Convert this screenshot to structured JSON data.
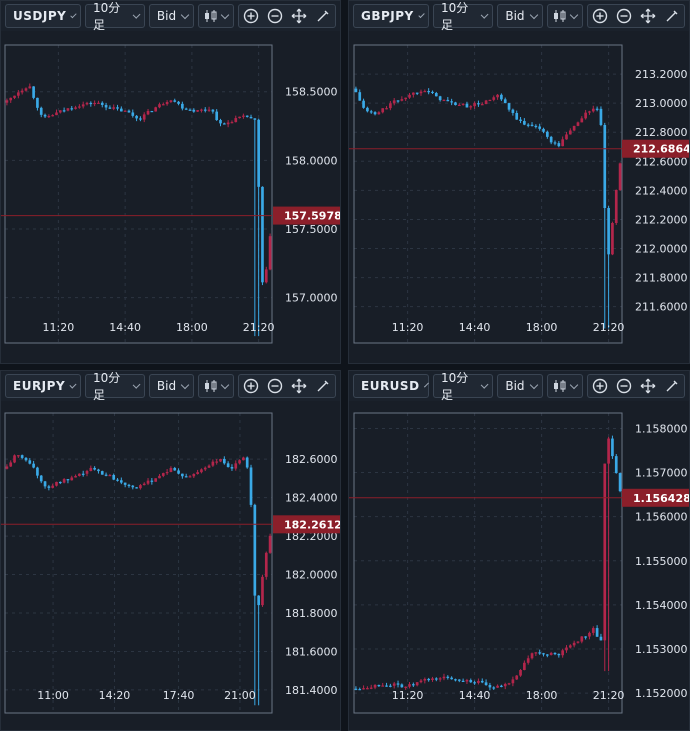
{
  "theme": {
    "up": "#b3264b",
    "down": "#3aa9e6",
    "last": "#8b1f2a",
    "grid": "#2c3542",
    "frame": "#6a7585"
  },
  "panels": [
    {
      "symbol": "USDJPY",
      "interval": "10分足",
      "price_type": "Bid",
      "chart_data": {
        "type": "candlestick",
        "ylim": [
          156.67,
          158.84
        ],
        "yticks": [
          "158.5000",
          "158.0000",
          "157.5000",
          "157.0000"
        ],
        "ytick_values": [
          158.5,
          158.0,
          157.5,
          157.0
        ],
        "xticks": [
          "11:20",
          "14:40",
          "18:00",
          "21:20"
        ],
        "xtick_pos": [
          0.2,
          0.45,
          0.7,
          0.95
        ],
        "last_price": "157.5978",
        "last_value": 157.5978,
        "close_path": [
          [
            0,
            158.42
          ],
          [
            0.05,
            158.5
          ],
          [
            0.09,
            158.55
          ],
          [
            0.14,
            158.3
          ],
          [
            0.2,
            158.35
          ],
          [
            0.27,
            158.4
          ],
          [
            0.34,
            158.42
          ],
          [
            0.4,
            158.38
          ],
          [
            0.46,
            158.35
          ],
          [
            0.5,
            158.3
          ],
          [
            0.56,
            158.38
          ],
          [
            0.62,
            158.45
          ],
          [
            0.67,
            158.38
          ],
          [
            0.72,
            158.36
          ],
          [
            0.77,
            158.38
          ],
          [
            0.81,
            158.25
          ],
          [
            0.86,
            158.3
          ],
          [
            0.91,
            158.32
          ],
          [
            0.94,
            158.28
          ],
          [
            0.95,
            157.8
          ],
          [
            0.96,
            157.15
          ],
          [
            0.97,
            157.05
          ],
          [
            0.985,
            157.3
          ],
          [
            1.0,
            157.6
          ]
        ],
        "spike_low": 156.72
      }
    },
    {
      "symbol": "GBPJPY",
      "interval": "10分足",
      "price_type": "Bid",
      "chart_data": {
        "type": "candlestick",
        "ylim": [
          211.35,
          213.4
        ],
        "yticks": [
          "213.2000",
          "213.0000",
          "212.8000",
          "212.6000",
          "212.4000",
          "212.2000",
          "212.0000",
          "211.8000",
          "211.6000"
        ],
        "ytick_values": [
          213.2,
          213.0,
          212.8,
          212.6,
          212.4,
          212.2,
          212.0,
          211.8,
          211.6
        ],
        "xticks": [
          "11:20",
          "14:40",
          "18:00",
          "21:20"
        ],
        "xtick_pos": [
          0.2,
          0.45,
          0.7,
          0.95
        ],
        "last_price": "212.6864",
        "last_value": 212.6864,
        "close_path": [
          [
            0,
            213.1
          ],
          [
            0.04,
            212.95
          ],
          [
            0.08,
            212.92
          ],
          [
            0.14,
            213.0
          ],
          [
            0.2,
            213.05
          ],
          [
            0.26,
            213.1
          ],
          [
            0.3,
            213.05
          ],
          [
            0.36,
            213.0
          ],
          [
            0.42,
            212.98
          ],
          [
            0.48,
            213.0
          ],
          [
            0.54,
            213.05
          ],
          [
            0.58,
            212.95
          ],
          [
            0.63,
            212.85
          ],
          [
            0.68,
            212.85
          ],
          [
            0.73,
            212.75
          ],
          [
            0.76,
            212.7
          ],
          [
            0.8,
            212.8
          ],
          [
            0.86,
            212.92
          ],
          [
            0.9,
            212.98
          ],
          [
            0.92,
            212.9
          ],
          [
            0.935,
            212.3
          ],
          [
            0.95,
            211.95
          ],
          [
            0.97,
            212.25
          ],
          [
            0.985,
            212.5
          ],
          [
            1.0,
            212.68
          ]
        ],
        "spike_low": 211.45
      }
    },
    {
      "symbol": "EURJPY",
      "interval": "10分足",
      "price_type": "Bid",
      "chart_data": {
        "type": "candlestick",
        "ylim": [
          181.28,
          182.84
        ],
        "yticks": [
          "182.6000",
          "182.4000",
          "182.2000",
          "182.0000",
          "181.8000",
          "181.6000",
          "181.4000"
        ],
        "ytick_values": [
          182.6,
          182.4,
          182.2,
          182.0,
          181.8,
          181.6,
          181.4
        ],
        "xticks": [
          "11:00",
          "14:20",
          "17:40",
          "21:00"
        ],
        "xtick_pos": [
          0.18,
          0.41,
          0.65,
          0.88
        ],
        "last_price": "182.2612",
        "last_value": 182.2612,
        "close_path": [
          [
            0,
            182.55
          ],
          [
            0.04,
            182.62
          ],
          [
            0.08,
            182.6
          ],
          [
            0.11,
            182.55
          ],
          [
            0.15,
            182.45
          ],
          [
            0.2,
            182.48
          ],
          [
            0.26,
            182.5
          ],
          [
            0.32,
            182.55
          ],
          [
            0.38,
            182.52
          ],
          [
            0.44,
            182.48
          ],
          [
            0.5,
            182.45
          ],
          [
            0.56,
            182.5
          ],
          [
            0.62,
            182.55
          ],
          [
            0.68,
            182.5
          ],
          [
            0.74,
            182.55
          ],
          [
            0.8,
            182.6
          ],
          [
            0.85,
            182.55
          ],
          [
            0.9,
            182.62
          ],
          [
            0.92,
            182.45
          ],
          [
            0.93,
            181.9
          ],
          [
            0.95,
            181.85
          ],
          [
            0.97,
            182.05
          ],
          [
            0.985,
            182.15
          ],
          [
            1.0,
            182.26
          ]
        ],
        "spike_low": 181.32
      }
    },
    {
      "symbol": "EURUSD",
      "interval": "10分足",
      "price_type": "Bid",
      "chart_data": {
        "type": "candlestick",
        "ylim": [
          1.15155,
          1.15835
        ],
        "yticks": [
          "1.158000",
          "1.157000",
          "1.156000",
          "1.155000",
          "1.154000",
          "1.153000",
          "1.152000"
        ],
        "ytick_values": [
          1.158,
          1.157,
          1.156,
          1.155,
          1.154,
          1.153,
          1.152
        ],
        "xticks": [
          "11:20",
          "14:40",
          "18:00",
          "21:20"
        ],
        "xtick_pos": [
          0.2,
          0.45,
          0.7,
          0.95
        ],
        "last_price": "1.156428",
        "last_value": 1.156428,
        "close_path": [
          [
            0,
            1.1521
          ],
          [
            0.05,
            1.15215
          ],
          [
            0.12,
            1.1522
          ],
          [
            0.2,
            1.15215
          ],
          [
            0.27,
            1.1523
          ],
          [
            0.34,
            1.15235
          ],
          [
            0.4,
            1.1523
          ],
          [
            0.46,
            1.15225
          ],
          [
            0.52,
            1.1521
          ],
          [
            0.57,
            1.1522
          ],
          [
            0.62,
            1.1525
          ],
          [
            0.66,
            1.1529
          ],
          [
            0.71,
            1.1529
          ],
          [
            0.76,
            1.15285
          ],
          [
            0.81,
            1.1531
          ],
          [
            0.86,
            1.1533
          ],
          [
            0.9,
            1.1535
          ],
          [
            0.92,
            1.1528
          ],
          [
            0.935,
            1.1572
          ],
          [
            0.95,
            1.1578
          ],
          [
            0.97,
            1.1572
          ],
          [
            0.985,
            1.1568
          ],
          [
            1.0,
            1.15643
          ]
        ],
        "spike_low": 1.1525
      }
    }
  ]
}
